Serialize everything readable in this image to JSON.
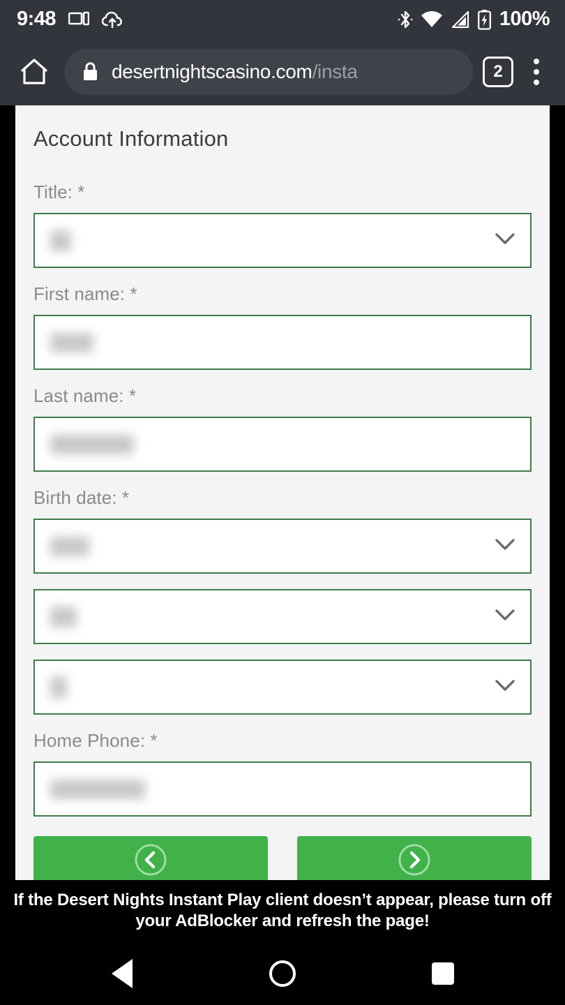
{
  "status_bar": {
    "clock": "9:48",
    "battery_text": "100%",
    "icons_left": [
      "cast-screen-icon",
      "cloud-upload-icon"
    ],
    "icons_right": [
      "bluetooth-icon",
      "wifi-icon",
      "cellular-signal-icon",
      "battery-charging-icon"
    ]
  },
  "browser": {
    "home_icon": "home-icon",
    "lock_icon": "lock-icon",
    "url_domain": "desertnightscasino.com",
    "url_path": "/insta",
    "tab_count": "2",
    "menu_icon": "overflow-menu-icon"
  },
  "page": {
    "section_title": "Account Information",
    "fields": [
      {
        "label": "Title: *",
        "type": "select",
        "value": "",
        "name": "title"
      },
      {
        "label": "First name: *",
        "type": "text",
        "value": "",
        "name": "first-name"
      },
      {
        "label": "Last name: *",
        "type": "text",
        "value": "",
        "name": "last-name"
      },
      {
        "label": "Birth date: *",
        "type": "select",
        "value": "",
        "name": "birth-month"
      },
      {
        "label": "",
        "type": "select",
        "value": "",
        "name": "birth-day"
      },
      {
        "label": "",
        "type": "select",
        "value": "",
        "name": "birth-year"
      },
      {
        "label": "Home Phone: *",
        "type": "text",
        "value": "",
        "name": "home-phone"
      }
    ],
    "buttons": {
      "prev_icon": "chevron-left-circle-icon",
      "next_icon": "chevron-right-circle-icon"
    },
    "accent_green": "#41b14a",
    "border_green": "#3e7b49"
  },
  "footer": {
    "message": "If the Desert Nights Instant Play client doesn’t appear, please turn off your AdBlocker and refresh the page!"
  },
  "android_nav": {
    "back": "back-icon",
    "home": "home-circle-icon",
    "recents": "recents-icon"
  }
}
